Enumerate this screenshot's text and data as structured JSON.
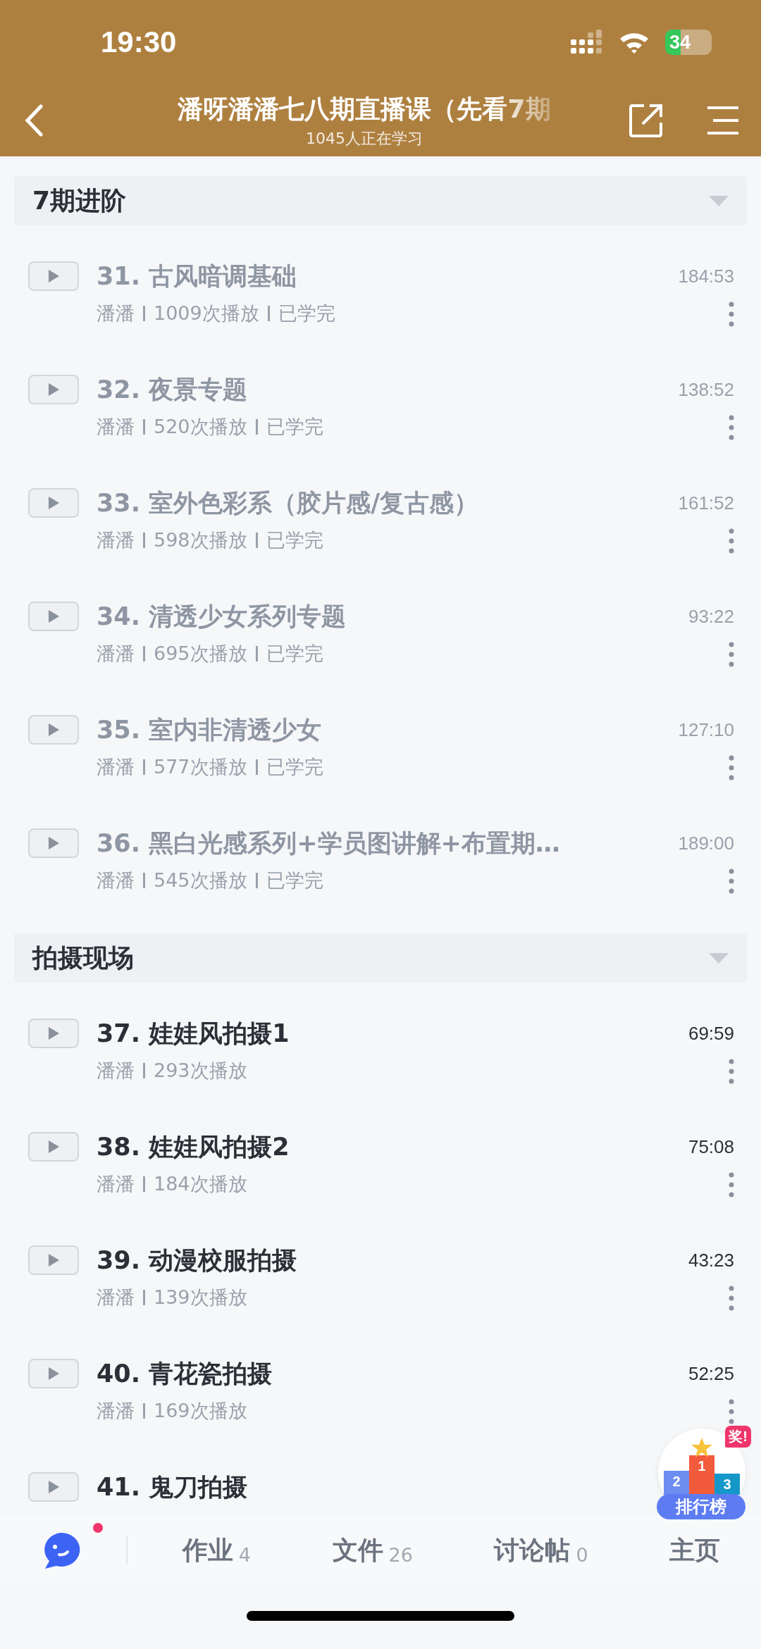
{
  "status_bar": {
    "time": "19:30",
    "battery": "34"
  },
  "header": {
    "title": "潘呀潘潘七八期直播课（先看7期",
    "subtitle": "1045人正在学习"
  },
  "sections": [
    {
      "title": "7期进阶",
      "expanded": true,
      "lessons": [
        {
          "title": "31. 古风暗调基础",
          "duration": "184:53",
          "teacher": "潘潘",
          "plays": "1009次播放",
          "status": "已学完",
          "watched": true
        },
        {
          "title": "32. 夜景专题",
          "duration": "138:52",
          "teacher": "潘潘",
          "plays": "520次播放",
          "status": "已学完",
          "watched": true
        },
        {
          "title": "33. 室外色彩系（胶片感/复古感）",
          "duration": "161:52",
          "teacher": "潘潘",
          "plays": "598次播放",
          "status": "已学完",
          "watched": true
        },
        {
          "title": "34. 清透少女系列专题",
          "duration": "93:22",
          "teacher": "潘潘",
          "plays": "695次播放",
          "status": "已学完",
          "watched": true
        },
        {
          "title": "35. 室内非清透少女",
          "duration": "127:10",
          "teacher": "潘潘",
          "plays": "577次播放",
          "status": "已学完",
          "watched": true
        },
        {
          "title": "36. 黑白光感系列+学员图讲解+布置期…",
          "duration": "189:00",
          "teacher": "潘潘",
          "plays": "545次播放",
          "status": "已学完",
          "watched": true
        }
      ]
    },
    {
      "title": "拍摄现场",
      "expanded": true,
      "lessons": [
        {
          "title": "37. 娃娃风拍摄1",
          "duration": "69:59",
          "teacher": "潘潘",
          "plays": "293次播放",
          "watched": false
        },
        {
          "title": "38. 娃娃风拍摄2",
          "duration": "75:08",
          "teacher": "潘潘",
          "plays": "184次播放",
          "watched": false
        },
        {
          "title": "39. 动漫校服拍摄",
          "duration": "43:23",
          "teacher": "潘潘",
          "plays": "139次播放",
          "watched": false
        },
        {
          "title": "40. 青花瓷拍摄",
          "duration": "52:25",
          "teacher": "潘潘",
          "plays": "169次播放",
          "watched": false
        },
        {
          "title": "41. 鬼刀拍摄",
          "watched": false
        }
      ]
    }
  ],
  "leaderboard": {
    "label": "排行榜",
    "badge": "奖!",
    "podium": [
      "2",
      "1",
      "3"
    ]
  },
  "bottom_bar": {
    "chat_unread": true,
    "tabs": [
      {
        "label": "作业",
        "count": "4"
      },
      {
        "label": "文件",
        "count": "26"
      },
      {
        "label": "讨论帖",
        "count": "0"
      },
      {
        "label": "主页"
      }
    ]
  }
}
